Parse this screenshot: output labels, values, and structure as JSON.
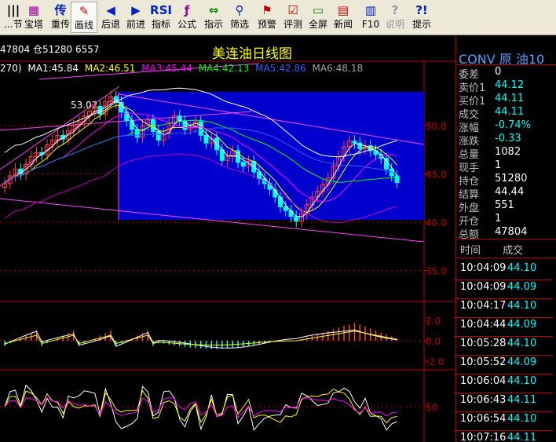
{
  "toolbar": [
    {
      "label": "...节",
      "icon": "|||",
      "color": "black"
    },
    {
      "label": "宝塔",
      "icon": "▦",
      "color": "purple"
    },
    {
      "label": "重传",
      "icon": "传",
      "color": "blue"
    },
    {
      "label": "画线",
      "icon": "✎",
      "color": "red",
      "active": true
    },
    {
      "label": "后退",
      "icon": "◀",
      "color": "blue"
    },
    {
      "label": "前进",
      "icon": "▶",
      "color": "blue"
    },
    {
      "label": "指标",
      "icon": "RSI",
      "color": "blue"
    },
    {
      "label": "公式",
      "icon": "ƒ",
      "color": "purple"
    },
    {
      "label": "指示",
      "icon": "⇔",
      "color": "green"
    },
    {
      "label": "筛选",
      "icon": "⚲",
      "color": "blue"
    },
    {
      "label": "预警",
      "icon": "⚑",
      "color": "red"
    },
    {
      "label": "评测",
      "icon": "☑",
      "color": "red"
    },
    {
      "label": "全屏",
      "icon": "▭",
      "color": "green"
    },
    {
      "label": "新闻",
      "icon": "▤",
      "color": "red"
    },
    {
      "label": "F10",
      "icon": "▥",
      "color": "blue"
    },
    {
      "label": "说明",
      "icon": "?",
      "color": "gray",
      "disabled": true
    },
    {
      "label": "提示",
      "icon": "?!",
      "color": "blue"
    }
  ],
  "chart": {
    "title": "美连油日线图",
    "info_line": "47804 仓51280 6557",
    "ma_prefix": "270)",
    "ma": [
      {
        "label": "MA1:45.84",
        "color": "#ffffff"
      },
      {
        "label": "MA2:46.51",
        "color": "#ffff00"
      },
      {
        "label": "MA3:45.44",
        "color": "#ff00ff"
      },
      {
        "label": "MA4:42.13",
        "color": "#00ff00"
      },
      {
        "label": "MA5:42.86",
        "color": "#3060ff"
      },
      {
        "label": "MA6:48.18",
        "color": "#a0a0a0"
      }
    ],
    "price_axis": [
      "50.0",
      "45.0",
      "40.0",
      "35.0"
    ],
    "high_label": "53.02",
    "macd_axis": [
      "2.0",
      "0.0",
      "-2.0"
    ],
    "rsi_axis": [
      "50"
    ],
    "colors": {
      "up": "#ff4040",
      "down": "#00ffff",
      "highlight_box": "#0000cc",
      "border": "#c00000"
    }
  },
  "quote": {
    "header": "CONV 原 油10",
    "rows": [
      {
        "label": "委差",
        "value": "0",
        "color": "#ffffff"
      },
      {
        "label": "卖价1",
        "value": "44.12",
        "color": "#00ffff"
      },
      {
        "label": "买价1",
        "value": "44.11",
        "color": "#00ffff"
      },
      {
        "label": "成交",
        "value": "44.11",
        "color": "#00ffff"
      },
      {
        "label": "涨幅",
        "value": "-0.74%",
        "color": "#00ffff"
      },
      {
        "label": "涨跌",
        "value": "-0.33",
        "color": "#00ffff"
      },
      {
        "label": "总量",
        "value": "1082",
        "color": "#ffffff"
      },
      {
        "label": "现手",
        "value": "1",
        "color": "#ffffff"
      },
      {
        "label": "持仓",
        "value": "51280",
        "color": "#ffffff"
      },
      {
        "label": "结算",
        "value": "44.44",
        "color": "#ffffff"
      },
      {
        "label": "外盘",
        "value": "551",
        "color": "#ffffff"
      },
      {
        "label": "开仓",
        "value": "1",
        "color": "#ffffff"
      },
      {
        "label": "总额",
        "value": "47804",
        "color": "#ffffff"
      }
    ]
  },
  "trades": {
    "header_time": "时间",
    "header_price": "成交",
    "rows": [
      {
        "time": "10:04:09",
        "price": "44.10"
      },
      {
        "time": "10:04:09",
        "price": "44.09"
      },
      {
        "time": "10:04:17",
        "price": "44.10"
      },
      {
        "time": "10:04:44",
        "price": "44.09"
      },
      {
        "time": "10:05:28",
        "price": "44.10"
      },
      {
        "time": "10:05:52",
        "price": "44.09"
      },
      {
        "time": "10:06:04",
        "price": "44.10"
      },
      {
        "time": "10:06:43",
        "price": "44.11"
      },
      {
        "time": "10:06:54",
        "price": "44.10"
      },
      {
        "time": "10:07:16",
        "price": "44.11"
      }
    ]
  }
}
